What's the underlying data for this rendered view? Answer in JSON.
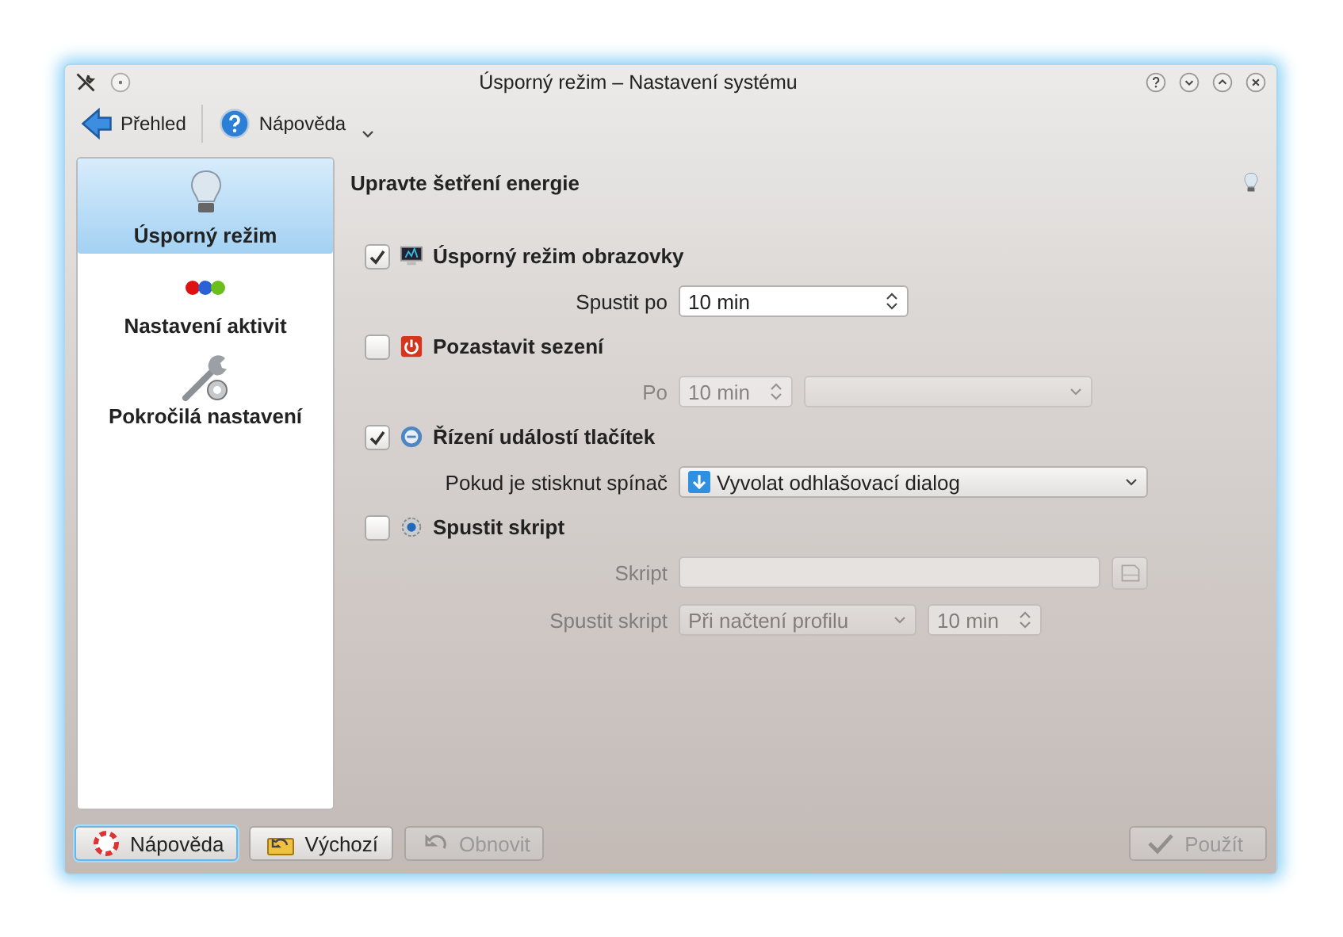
{
  "window": {
    "title": "Úsporný režim – Nastavení systému"
  },
  "toolbar": [
    {
      "label": "Přehled",
      "kind": "back"
    },
    {
      "label": "Nápověda",
      "kind": "help"
    }
  ],
  "sidebar": {
    "items": [
      {
        "label": "Úsporný režim",
        "selected": true
      },
      {
        "label": "Nastavení aktivit",
        "selected": false
      },
      {
        "label": "Pokročilá nastavení",
        "selected": false
      }
    ]
  },
  "content": {
    "heading": "Upravte šetření energie",
    "sections": [
      {
        "label": "Úsporný režim obrazovky",
        "checked": true,
        "fields": [
          {
            "label": "Spustit po",
            "controls": [
              {
                "kind": "spinbox",
                "value": "10 min"
              }
            ]
          }
        ]
      },
      {
        "label": "Pozastavit sezení",
        "checked": false,
        "fields": [
          {
            "label": "Po",
            "controls": [
              {
                "kind": "spinbox",
                "value": "10 min"
              },
              {
                "kind": "combo"
              }
            ]
          }
        ]
      },
      {
        "label": "Řízení událostí tlačítek",
        "checked": true,
        "fields": [
          {
            "label": "Pokud je stisknut spínač",
            "controls": [
              {
                "kind": "icon-combo",
                "value": "Vyvolat odhlašovací dialog"
              }
            ]
          }
        ]
      },
      {
        "label": "Spustit skript",
        "checked": false,
        "fields": [
          {
            "label": "Skript",
            "controls": [
              {
                "kind": "text"
              },
              {
                "kind": "file-button"
              }
            ]
          },
          {
            "label": "Spustit skript",
            "controls": [
              {
                "kind": "combo",
                "value": "Při načtení profilu"
              },
              {
                "kind": "spinbox",
                "value": "10 min"
              }
            ]
          }
        ]
      }
    ]
  },
  "buttons": [
    {
      "label": "Nápověda",
      "disabled": false,
      "focused": true
    },
    {
      "label": "Výchozí",
      "disabled": false,
      "focused": false
    },
    {
      "label": "Obnovit",
      "disabled": true,
      "focused": false
    },
    {
      "label": "Použít",
      "disabled": true,
      "focused": false
    }
  ]
}
